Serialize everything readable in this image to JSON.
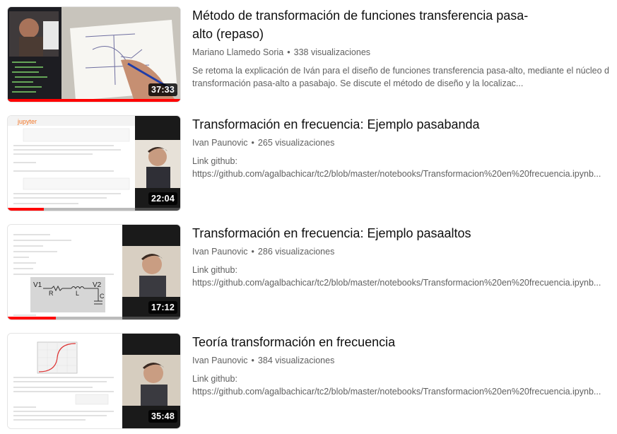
{
  "videos": [
    {
      "title": "Método de transformación de funciones transferencia pasa-alto (repaso)",
      "title_line1": "Método de transformación de funciones transferencia pasa-",
      "title_line2": "alto (repaso)",
      "channel": "Mariano Llamedo Soria",
      "views": "338 visualizaciones",
      "description_line1": "Se retoma la explicación de Iván para el diseño de funciones transferencia pasa-alto, mediante el núcleo de",
      "description_line2": "transformación pasa-alto a pasabajo. Se discute el método de diseño y la localizac...",
      "duration": "37:33",
      "watched": 1.0
    },
    {
      "title": "Transformación en frecuencia: Ejemplo pasabanda",
      "channel": "Ivan Paunovic",
      "views": "265 visualizaciones",
      "description_line1": "Link github:",
      "description_line2": "https://github.com/agalbachicar/tc2/blob/master/notebooks/Transformacion%20en%20frecuencia.ipynb...",
      "duration": "22:04",
      "thumb_header": "jupyter",
      "watched": 0.2
    },
    {
      "title": "Transformación en frecuencia: Ejemplo pasaaltos",
      "channel": "Ivan Paunovic",
      "views": "286 visualizaciones",
      "description_line1": "Link github:",
      "description_line2": "https://github.com/agalbachicar/tc2/blob/master/notebooks/Transformacion%20en%20frecuencia.ipynb...",
      "duration": "17:12",
      "thumb_labels": [
        "V1",
        "R",
        "L",
        "V2",
        "C"
      ],
      "watched": 0.28
    },
    {
      "title": "Teoría transformación en frecuencia",
      "channel": "Ivan Paunovic",
      "views": "384 visualizaciones",
      "description_line1": "Link github:",
      "description_line2": "https://github.com/agalbachicar/tc2/blob/master/notebooks/Transformacion%20en%20frecuencia.ipynb...",
      "duration": "35:48",
      "watched": 0.0
    }
  ],
  "channel_separator": "•",
  "colors": {
    "progress": "#ff0000",
    "meta_text": "#606060",
    "title_text": "#0f0f0f"
  }
}
